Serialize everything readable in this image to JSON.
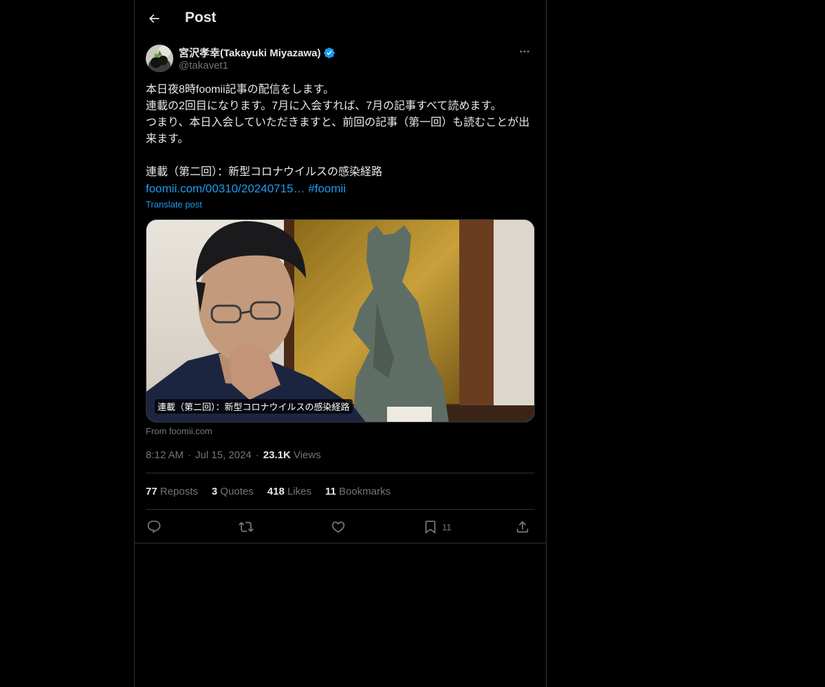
{
  "header": {
    "title": "Post",
    "back_icon": "arrow-left-icon"
  },
  "author": {
    "display_name": "宮沢孝幸(Takayuki Miyazawa)",
    "handle": "@takavet1",
    "verified": true,
    "verified_color": "#1d9bf0"
  },
  "tweet": {
    "text": "本日夜8時foomii記事の配信をします。\n連載の2回目になります。7月に入会すれば、7月の記事すべて読めます。\nつまり、本日入会していただきますと、前回の記事（第一回）も読むことが出来ます。\n\n連載（第二回）：新型コロナウイルスの感染経路",
    "link_text": "foomii.com/00310/20240715…",
    "hashtag": "#foomii",
    "translate_label": "Translate post"
  },
  "card": {
    "caption": "連載（第二回）：新型コロナウイルスの感染経路",
    "source": "From foomii.com"
  },
  "meta": {
    "time": "8:12 AM",
    "date": "Jul 15, 2024",
    "views_count": "23.1K",
    "views_label": "Views"
  },
  "stats": {
    "reposts_count": "77",
    "reposts_label": "Reposts",
    "quotes_count": "3",
    "quotes_label": "Quotes",
    "likes_count": "418",
    "likes_label": "Likes",
    "bookmarks_count": "11",
    "bookmarks_label": "Bookmarks"
  },
  "actions": {
    "bookmark_count": "11"
  },
  "colors": {
    "background": "#000000",
    "text": "#e7e9ea",
    "muted": "#71767b",
    "accent": "#1d9bf0",
    "border": "#2f3336"
  }
}
